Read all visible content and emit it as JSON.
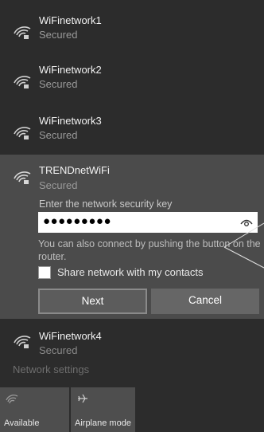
{
  "networks": [
    {
      "name": "WiFinetwork1",
      "status": "Secured"
    },
    {
      "name": "WiFinetwork2",
      "status": "Secured"
    },
    {
      "name": "WiFinetwork3",
      "status": "Secured"
    }
  ],
  "selected_network": {
    "name": "TRENDnetWiFi",
    "status": "Secured",
    "security_key_prompt": "Enter the network security key",
    "password_masked": "●●●●●●●●●",
    "wps_hint": "You can also connect by pushing the button on the router.",
    "share_label": "Share network with my contacts",
    "share_checked": false,
    "next_label": "Next",
    "cancel_label": "Cancel"
  },
  "network4": {
    "name": "WiFinetwork4",
    "status": "Secured"
  },
  "network_settings_label": "Network settings",
  "quick_actions": [
    {
      "label": "Available",
      "icon": "wifi-icon"
    },
    {
      "label": "Airplane mode",
      "icon": "airplane-icon"
    }
  ],
  "colors": {
    "background": "#2c2c2c",
    "expanded_panel": "#4b4b4b",
    "muted_text": "#9a9a9a",
    "button": "#5c5c5c"
  }
}
